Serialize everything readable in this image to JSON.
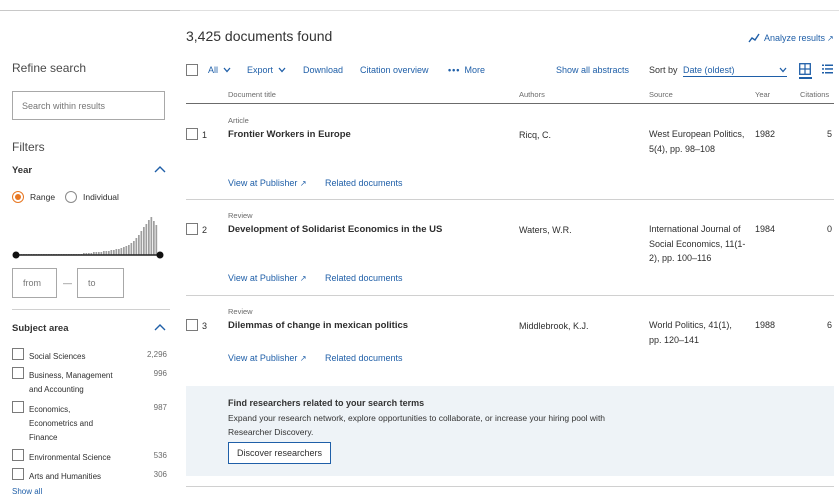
{
  "header": {
    "documents_found": "3,425 documents found",
    "analyze_results": "Analyze results"
  },
  "sidebar": {
    "refine_title": "Refine search",
    "search_placeholder": "Search within results",
    "filters_title": "Filters",
    "year": {
      "label": "Year",
      "range_label": "Range",
      "individual_label": "Individual",
      "selected_mode": "Range",
      "histogram": [
        1,
        1,
        1,
        1,
        1,
        1,
        1,
        1,
        1,
        1,
        1,
        1,
        1,
        1,
        1,
        1,
        1,
        1,
        1,
        1,
        1,
        1,
        1,
        1,
        1,
        1,
        2,
        2,
        2,
        2,
        3,
        3,
        3,
        3,
        4,
        4,
        4,
        5,
        5,
        6,
        6,
        7,
        8,
        9,
        10,
        12,
        14,
        17,
        20,
        24,
        28,
        31,
        35,
        38,
        34,
        30
      ],
      "from_placeholder": "from",
      "to_placeholder": "to",
      "dash": "—"
    },
    "subject_area": {
      "label": "Subject area",
      "items": [
        {
          "label": "Social Sciences",
          "count": "2,296"
        },
        {
          "label": "Business, Management and Accounting",
          "count": "996"
        },
        {
          "label": "Economics, Econometrics and Finance",
          "count": "987"
        },
        {
          "label": "Environmental Science",
          "count": "536"
        },
        {
          "label": "Arts and Humanities",
          "count": "306"
        }
      ],
      "show_all": "Show all"
    }
  },
  "toolbar": {
    "all": "All",
    "export": "Export",
    "download": "Download",
    "citation_overview": "Citation overview",
    "more": "More",
    "show_all_abstracts": "Show all abstracts",
    "sort_by_label": "Sort by",
    "sort_value": "Date (oldest)"
  },
  "table": {
    "headers": {
      "title": "Document title",
      "authors": "Authors",
      "source": "Source",
      "year": "Year",
      "citations": "Citations"
    },
    "rows": [
      {
        "number": "1",
        "type": "Article",
        "title": "Frontier Workers in Europe",
        "authors": "Ricq, C.",
        "source": "West European Politics, 5(4), pp. 98–108",
        "year": "1982",
        "citations": "5",
        "view_publisher": "View at Publisher",
        "related": "Related documents"
      },
      {
        "number": "2",
        "type": "Review",
        "title": "Development of Solidarist Economics in the US",
        "authors": "Waters, W.R.",
        "source": "International Journal of Social Economics, 11(1-2), pp. 100–116",
        "year": "1984",
        "citations": "0",
        "view_publisher": "View at Publisher",
        "related": "Related documents"
      },
      {
        "number": "3",
        "type": "Review",
        "title": "Dilemmas of change in mexican politics",
        "authors": "Middlebrook, K.J.",
        "source": "World Politics, 41(1), pp. 120–141",
        "year": "1988",
        "citations": "6",
        "view_publisher": "View at Publisher",
        "related": "Related documents"
      }
    ]
  },
  "promo": {
    "title": "Find researchers related to your search terms",
    "body": "Expand your research network, explore opportunities to collaborate, or increase your hiring pool with Researcher Discovery.",
    "button": "Discover researchers"
  },
  "colors": {
    "accent": "#e87722",
    "link": "#1f5fa8",
    "promo_bg": "#eef3f7"
  }
}
